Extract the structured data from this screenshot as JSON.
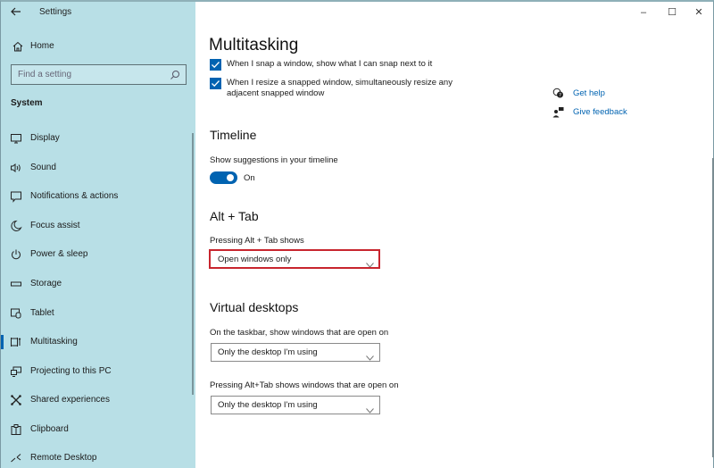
{
  "window": {
    "title": "Settings",
    "controls": {
      "minimize": "–",
      "maximize": "☐",
      "close": "✕"
    }
  },
  "sidebar": {
    "back_icon": "back-arrow-icon",
    "home": {
      "label": "Home",
      "icon": "home-icon"
    },
    "search": {
      "placeholder": "Find a setting",
      "value": "",
      "icon": "search-icon"
    },
    "section": "System",
    "items": [
      {
        "label": "Display",
        "icon": "display-icon",
        "active": false
      },
      {
        "label": "Sound",
        "icon": "sound-icon",
        "active": false
      },
      {
        "label": "Notifications & actions",
        "icon": "notifications-icon",
        "active": false
      },
      {
        "label": "Focus assist",
        "icon": "focus-assist-icon",
        "active": false
      },
      {
        "label": "Power & sleep",
        "icon": "power-icon",
        "active": false
      },
      {
        "label": "Storage",
        "icon": "storage-icon",
        "active": false
      },
      {
        "label": "Tablet",
        "icon": "tablet-icon",
        "active": false
      },
      {
        "label": "Multitasking",
        "icon": "multitasking-icon",
        "active": true
      },
      {
        "label": "Projecting to this PC",
        "icon": "projecting-icon",
        "active": false
      },
      {
        "label": "Shared experiences",
        "icon": "shared-experiences-icon",
        "active": false
      },
      {
        "label": "Clipboard",
        "icon": "clipboard-icon",
        "active": false
      },
      {
        "label": "Remote Desktop",
        "icon": "remote-desktop-icon",
        "active": false
      }
    ]
  },
  "main": {
    "title": "Multitasking",
    "snap": {
      "options": [
        {
          "label": "When I snap a window, show what I can snap next to it",
          "checked": true
        },
        {
          "label": "When I resize a snapped window, simultaneously resize any adjacent snapped window",
          "checked": true
        }
      ]
    },
    "help_links": [
      {
        "label": "Get help",
        "icon": "get-help-icon"
      },
      {
        "label": "Give feedback",
        "icon": "give-feedback-icon"
      }
    ],
    "timeline": {
      "heading": "Timeline",
      "label": "Show suggestions in your timeline",
      "toggle_state": "On",
      "toggle_on": true
    },
    "alt_tab": {
      "heading": "Alt + Tab",
      "label": "Pressing Alt + Tab shows",
      "selected": "Open windows only",
      "highlight_color": "#c8252e"
    },
    "virtual_desktops": {
      "heading": "Virtual desktops",
      "taskbar_label": "On the taskbar, show windows that are open on",
      "taskbar_selected": "Only the desktop I'm using",
      "alttab_label": "Pressing Alt+Tab shows windows that are open on",
      "alttab_selected": "Only the desktop I'm using"
    }
  },
  "colors": {
    "accent": "#0063b1",
    "sidebar_bg": "#b8dfe6",
    "link": "#0063b1"
  }
}
